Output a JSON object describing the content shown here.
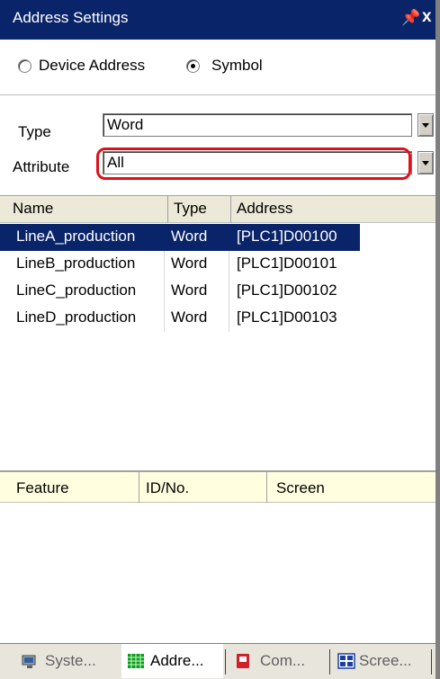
{
  "window": {
    "title": "Address Settings",
    "pin_glyph": "ȣ",
    "close_glyph": "x"
  },
  "address_mode": {
    "options": [
      {
        "label": "Device Address",
        "checked": false
      },
      {
        "label": "Symbol",
        "checked": true
      }
    ]
  },
  "filters": {
    "type_label": "Type",
    "type_value": "Word",
    "attribute_label": "Attribute",
    "attribute_value": "All"
  },
  "symbol_table": {
    "columns": [
      "Name",
      "Type",
      "Address"
    ],
    "rows": [
      {
        "name": "LineA_production",
        "type": "Word",
        "address": "[PLC1]D00100",
        "selected": true
      },
      {
        "name": "LineB_production",
        "type": "Word",
        "address": "[PLC1]D00101",
        "selected": false
      },
      {
        "name": "LineC_production",
        "type": "Word",
        "address": "[PLC1]D00102",
        "selected": false
      },
      {
        "name": "LineD_production",
        "type": "Word",
        "address": "[PLC1]D00103",
        "selected": false
      }
    ]
  },
  "usage_table": {
    "columns": [
      "Feature",
      "ID/No.",
      "Screen"
    ]
  },
  "tabs": [
    {
      "label": "Syste...",
      "icon": "system-settings-icon",
      "active": false
    },
    {
      "label": "Addre...",
      "icon": "address-grid-icon",
      "active": true
    },
    {
      "label": "Com...",
      "icon": "common-settings-icon",
      "active": false
    },
    {
      "label": "Scree...",
      "icon": "screen-list-icon",
      "active": false
    }
  ],
  "colors": {
    "title_bar": "#0a246a",
    "selection": "#0a246a",
    "highlight": "#e0101a",
    "usage_header": "#ffffe0"
  }
}
